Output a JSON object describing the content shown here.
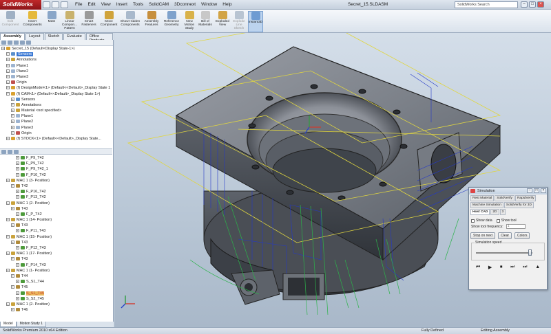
{
  "app": {
    "logo": "SolidWorks",
    "window_title": "Secret_15.SLDASM",
    "search_placeholder": "SolidWorks Search"
  },
  "menu": [
    "File",
    "Edit",
    "View",
    "Insert",
    "Tools",
    "SolidCAM",
    "3Dconnext",
    "Window",
    "Help"
  ],
  "ribbon": [
    {
      "label": "Edit Component",
      "icon": "edit-component-icon",
      "enabled": false,
      "color": "#9fb0c4"
    },
    {
      "label": "Insert Components",
      "icon": "insert-components-icon",
      "enabled": true,
      "color": "#e5b93a"
    },
    {
      "label": "Mate",
      "icon": "mate-icon",
      "enabled": true,
      "color": "#8aa6c8"
    },
    {
      "label": "Linear Compon... Pattern",
      "icon": "linear-pattern-icon",
      "enabled": true,
      "color": "#c9b26d"
    },
    {
      "label": "Smart Fasteners",
      "icon": "smart-fasteners-icon",
      "enabled": true,
      "color": "#9a9a9a"
    },
    {
      "label": "Move Component",
      "icon": "move-component-icon",
      "enabled": true,
      "color": "#d0a33b"
    },
    {
      "label": "Show Hidden Components",
      "icon": "show-hidden-icon",
      "enabled": true,
      "color": "#a9b9cc"
    },
    {
      "label": "Assembly Features",
      "icon": "assembly-features-icon",
      "enabled": true,
      "color": "#c78f3d"
    },
    {
      "label": "Reference Geometry",
      "icon": "reference-geometry-icon",
      "enabled": true,
      "color": "#7fa2cc"
    },
    {
      "label": "New Motion Study",
      "icon": "motion-study-icon",
      "enabled": true,
      "color": "#d9b24a"
    },
    {
      "label": "Bill of Materials",
      "icon": "bill-of-materials-icon",
      "enabled": true,
      "color": "#c8c8c8"
    },
    {
      "label": "Exploded View",
      "icon": "exploded-view-icon",
      "enabled": true,
      "color": "#d2a446"
    },
    {
      "label": "Explode Line Sketch",
      "icon": "explode-line-icon",
      "enabled": false,
      "color": "#b8c4d2"
    },
    {
      "label": "Instant3D",
      "icon": "instant3d-icon",
      "enabled": true,
      "active": true,
      "color": "#6e9bd2"
    }
  ],
  "cm_tabs": [
    {
      "label": "Assembly",
      "active": true
    },
    {
      "label": "Layout"
    },
    {
      "label": "Sketch"
    },
    {
      "label": "Evaluate"
    },
    {
      "label": "Office Products"
    }
  ],
  "tree_top": [
    {
      "label": "Secret_15  (Default<Display State-1>)",
      "indent": 0,
      "icon": "assembly-icon",
      "color": "#d8a030"
    },
    {
      "label": "Sensors",
      "indent": 1,
      "icon": "sensor-icon",
      "color": "#5a8fcc",
      "hl": true
    },
    {
      "label": "Annotations",
      "indent": 1,
      "icon": "annotations-icon",
      "color": "#c9a23b"
    },
    {
      "label": "Plane1",
      "indent": 1,
      "icon": "plane-icon",
      "color": "#9cb3d0"
    },
    {
      "label": "Plane2",
      "indent": 1,
      "icon": "plane-icon",
      "color": "#9cb3d0"
    },
    {
      "label": "Plane3",
      "indent": 1,
      "icon": "plane-icon",
      "color": "#9cb3d0"
    },
    {
      "label": "Origin",
      "indent": 1,
      "icon": "origin-icon",
      "color": "#c0504d"
    },
    {
      "label": "(f) DesignModel<1> (Default<<Default>_Display State 1",
      "indent": 1,
      "icon": "part-icon",
      "color": "#d8a030"
    },
    {
      "label": "(f) CAM<1> (Default<<Default>_Display State 1>)",
      "indent": 1,
      "icon": "part-icon",
      "color": "#d8a030"
    },
    {
      "label": "Sensors",
      "indent": 2,
      "icon": "sensor-icon",
      "color": "#5a8fcc"
    },
    {
      "label": "Annotations",
      "indent": 2,
      "icon": "annotations-icon",
      "color": "#c9a23b"
    },
    {
      "label": "Material <not specified>",
      "indent": 2,
      "icon": "material-icon",
      "color": "#c9a23b"
    },
    {
      "label": "Plane1",
      "indent": 2,
      "icon": "plane-icon",
      "color": "#9cb3d0"
    },
    {
      "label": "Plane2",
      "indent": 2,
      "icon": "plane-icon",
      "color": "#9cb3d0"
    },
    {
      "label": "Plane3",
      "indent": 2,
      "icon": "plane-icon",
      "color": "#9cb3d0"
    },
    {
      "label": "Origin",
      "indent": 2,
      "icon": "origin-icon",
      "color": "#c0504d"
    },
    {
      "label": "(f) STOCK<1> (Default<<Default>_Display State...",
      "indent": 1,
      "icon": "part-icon",
      "color": "#d8a030"
    }
  ],
  "tree_bottom": [
    {
      "label": "F_P9_T42",
      "indent": 3,
      "icon": "operation-icon",
      "color": "#4c9a3a"
    },
    {
      "label": "F_P9_T42",
      "indent": 3,
      "icon": "operation-icon",
      "color": "#4c9a3a"
    },
    {
      "label": "F_P9_T42_1",
      "indent": 3,
      "icon": "operation-icon",
      "color": "#4c9a3a"
    },
    {
      "label": "F_P10_T42",
      "indent": 3,
      "icon": "operation-icon",
      "color": "#4c9a3a"
    },
    {
      "label": "MAC 1 (3- Position)",
      "indent": 1,
      "icon": "machine-icon",
      "color": "#c9a23b"
    },
    {
      "label": "T42",
      "indent": 2,
      "icon": "tool-icon",
      "color": "#b08a3a"
    },
    {
      "label": "F_P16_T42",
      "indent": 3,
      "icon": "operation-icon",
      "color": "#4c9a3a"
    },
    {
      "label": "F_P13_T42",
      "indent": 3,
      "icon": "operation-icon",
      "color": "#4c9a3a"
    },
    {
      "label": "MAC 1 (2- Position)",
      "indent": 1,
      "icon": "machine-icon",
      "color": "#c9a23b"
    },
    {
      "label": "T43",
      "indent": 2,
      "icon": "tool-icon",
      "color": "#b08a3a"
    },
    {
      "label": "F_P_T42",
      "indent": 3,
      "icon": "operation-icon",
      "color": "#4c9a3a"
    },
    {
      "label": "MAC 1 (14- Position)",
      "indent": 1,
      "icon": "machine-icon",
      "color": "#c9a23b"
    },
    {
      "label": "T43",
      "indent": 2,
      "icon": "tool-icon",
      "color": "#b08a3a"
    },
    {
      "label": "F_P11_T43",
      "indent": 3,
      "icon": "operation-icon",
      "color": "#4c9a3a"
    },
    {
      "label": "MAC 1 (15- Position)",
      "indent": 1,
      "icon": "machine-icon",
      "color": "#c9a23b"
    },
    {
      "label": "T43",
      "indent": 2,
      "icon": "tool-icon",
      "color": "#b08a3a"
    },
    {
      "label": "F_P12_T43",
      "indent": 3,
      "icon": "operation-icon",
      "color": "#4c9a3a"
    },
    {
      "label": "MAC 1 (17- Position)",
      "indent": 1,
      "icon": "machine-icon",
      "color": "#c9a23b"
    },
    {
      "label": "T43",
      "indent": 2,
      "icon": "tool-icon",
      "color": "#b08a3a"
    },
    {
      "label": "F_P14_T43",
      "indent": 3,
      "icon": "operation-icon",
      "color": "#4c9a3a"
    },
    {
      "label": "MAC 1 (1- Position)",
      "indent": 1,
      "icon": "machine-icon",
      "color": "#c9a23b"
    },
    {
      "label": "T44",
      "indent": 2,
      "icon": "tool-icon",
      "color": "#b08a3a"
    },
    {
      "label": "S_S1_T44",
      "indent": 3,
      "icon": "operation-icon",
      "color": "#4c9a3a"
    },
    {
      "label": "T45",
      "indent": 2,
      "icon": "tool-icon",
      "color": "#b08a3a"
    },
    {
      "label": "S_S1_T45",
      "indent": 3,
      "icon": "operation-icon",
      "color": "#4c9a3a",
      "red": true
    },
    {
      "label": "S_S2_T45",
      "indent": 3,
      "icon": "operation-icon",
      "color": "#4c9a3a"
    },
    {
      "label": "MAC 1 (2- Position)",
      "indent": 1,
      "icon": "machine-icon",
      "color": "#c9a23b"
    },
    {
      "label": "T46",
      "indent": 2,
      "icon": "tool-icon",
      "color": "#b08a3a"
    }
  ],
  "bottom_tabs": [
    {
      "label": "Model",
      "active": true
    },
    {
      "label": "Motion Study 1"
    }
  ],
  "status": {
    "left": "SolidWorks Premium 2010 x64 Edition",
    "mid": "Fully Defined",
    "right": "Editing Assembly"
  },
  "simulation": {
    "title": "Simulation",
    "tabs_row1": [
      "Rest Material",
      "SolidVerify",
      "RapidVerify"
    ],
    "tabs_row2": [
      "Machine Simulation",
      "SolidVerify for 3D"
    ],
    "tabs_row3": [
      {
        "label": "Host CAD",
        "active": true
      },
      {
        "label": "2D"
      },
      {
        "label": "3"
      }
    ],
    "show_data": "Show data",
    "show_tool": "Show tool",
    "freq_label": "Show tool frequency:",
    "freq_value": "1",
    "buttons": [
      "Stop on next",
      "Clear",
      "Colors"
    ],
    "speed_label": "Simulation speed",
    "speed": 0.95,
    "playback": [
      "⏮",
      "▶",
      "⏹",
      "⏭",
      "⏭",
      "▲"
    ]
  }
}
